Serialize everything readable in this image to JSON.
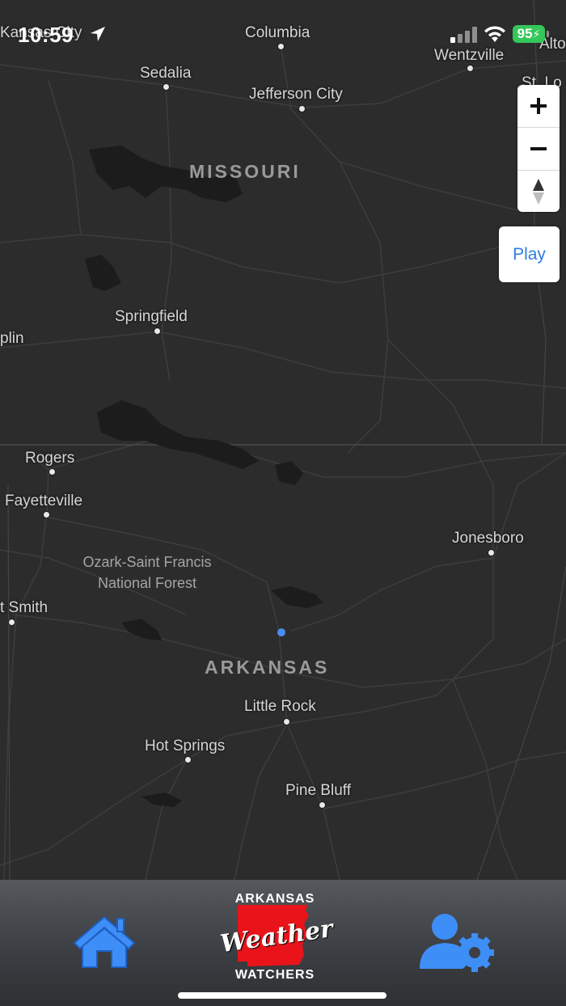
{
  "status_bar": {
    "time": "10:59",
    "battery": "95"
  },
  "map": {
    "cities": [
      {
        "key": "kansas_city",
        "name": "Kansas City"
      },
      {
        "key": "columbia",
        "name": "Columbia"
      },
      {
        "key": "wentzville",
        "name": "Wentzville"
      },
      {
        "key": "alton",
        "name": "Alton"
      },
      {
        "key": "st_louis",
        "name": "St. Lo"
      },
      {
        "key": "sedalia",
        "name": "Sedalia"
      },
      {
        "key": "jefferson_city",
        "name": "Jefferson City"
      },
      {
        "key": "springfield",
        "name": "Springfield"
      },
      {
        "key": "joplin",
        "name": "plin"
      },
      {
        "key": "rogers",
        "name": "Rogers"
      },
      {
        "key": "fayetteville",
        "name": "Fayetteville"
      },
      {
        "key": "jonesboro",
        "name": "Jonesboro"
      },
      {
        "key": "fort_smith",
        "name": "t Smith"
      },
      {
        "key": "little_rock",
        "name": "Little Rock"
      },
      {
        "key": "hot_springs",
        "name": "Hot Springs"
      },
      {
        "key": "pine_bluff",
        "name": "Pine Bluff"
      }
    ],
    "states": {
      "missouri": "MISSOURI",
      "arkansas": "ARKANSAS"
    },
    "forest": {
      "line1": "Ozark-Saint Francis",
      "line2": "National Forest"
    }
  },
  "controls": {
    "zoom_in_icon": "plus-icon",
    "zoom_out_icon": "minus-icon",
    "compass_icon": "compass-icon",
    "play_label": "Play"
  },
  "tab_bar": {
    "home_icon": "home-icon",
    "logo": {
      "top": "ARKANSAS",
      "script": "Weather",
      "bottom": "WATCHERS"
    },
    "settings_icon": "user-settings-icon"
  },
  "colors": {
    "accent_blue": "#4a8df0",
    "logo_red": "#e8141a",
    "battery_green": "#34c759",
    "play_blue": "#2f7de1"
  }
}
